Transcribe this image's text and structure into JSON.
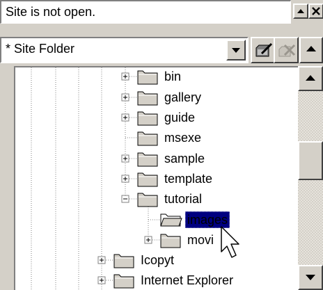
{
  "status": {
    "text": "Site is not open."
  },
  "site_folder": {
    "value": "* Site Folder"
  },
  "icons": {
    "title_up": "up-arrow-icon",
    "title_close": "close-icon",
    "combo_arrow": "dropdown-arrow-icon",
    "edit": "edit-folder-icon",
    "delete": "delete-icon",
    "folder": "folder-icon",
    "cursor": "mouse-pointer-icon"
  },
  "tree": {
    "nodes": [
      {
        "label": "bin",
        "expander": "+"
      },
      {
        "label": "gallery",
        "expander": "+"
      },
      {
        "label": "guide",
        "expander": "+"
      },
      {
        "label": "msexe",
        "expander": ""
      },
      {
        "label": "sample",
        "expander": "+"
      },
      {
        "label": "template",
        "expander": "+"
      },
      {
        "label": "tutorial",
        "expander": "-"
      },
      {
        "label": "images",
        "expander": "",
        "selected": true
      },
      {
        "label": "movi",
        "expander": "+"
      },
      {
        "label": "Icopyt",
        "expander": "+"
      },
      {
        "label": "Internet Explorer",
        "expander": "+"
      }
    ]
  },
  "colors": {
    "face": "#d4d0c8",
    "selection": "#000080",
    "window": "#ffffff"
  }
}
